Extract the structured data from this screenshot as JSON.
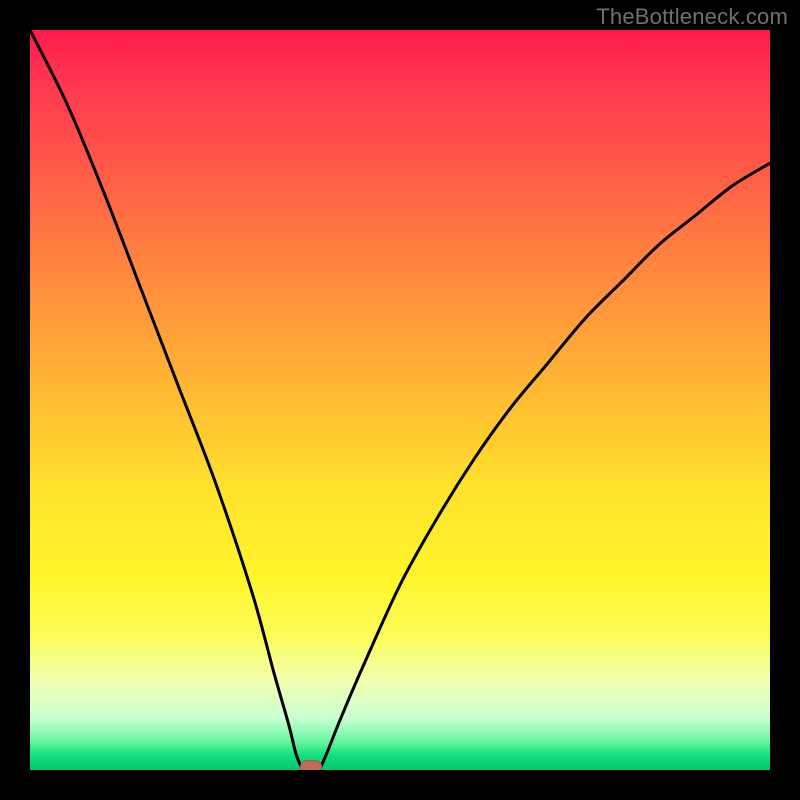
{
  "watermark": "TheBottleneck.com",
  "chart_data": {
    "type": "line",
    "title": "",
    "xlabel": "",
    "ylabel": "",
    "x_range": [
      0,
      100
    ],
    "y_range": [
      0,
      100
    ],
    "grid": false,
    "legend": false,
    "background_gradient_meaning": "red (top) = high bottleneck, green (bottom) = no bottleneck",
    "optimal_point": {
      "x": 38,
      "y": 0
    },
    "series": [
      {
        "name": "bottleneck-curve",
        "x": [
          0,
          5,
          10,
          15,
          20,
          25,
          30,
          33,
          35,
          36,
          37,
          38,
          39,
          40,
          42,
          45,
          50,
          55,
          60,
          65,
          70,
          75,
          80,
          85,
          90,
          95,
          100
        ],
        "y": [
          100,
          90,
          78,
          65,
          52,
          39,
          24,
          13,
          6,
          2,
          0,
          0,
          0,
          2,
          7,
          14,
          25,
          34,
          42,
          49,
          55,
          61,
          66,
          71,
          75,
          79,
          82
        ]
      }
    ],
    "marker": {
      "x": 38,
      "y": 0,
      "color": "#c46a5a"
    }
  }
}
